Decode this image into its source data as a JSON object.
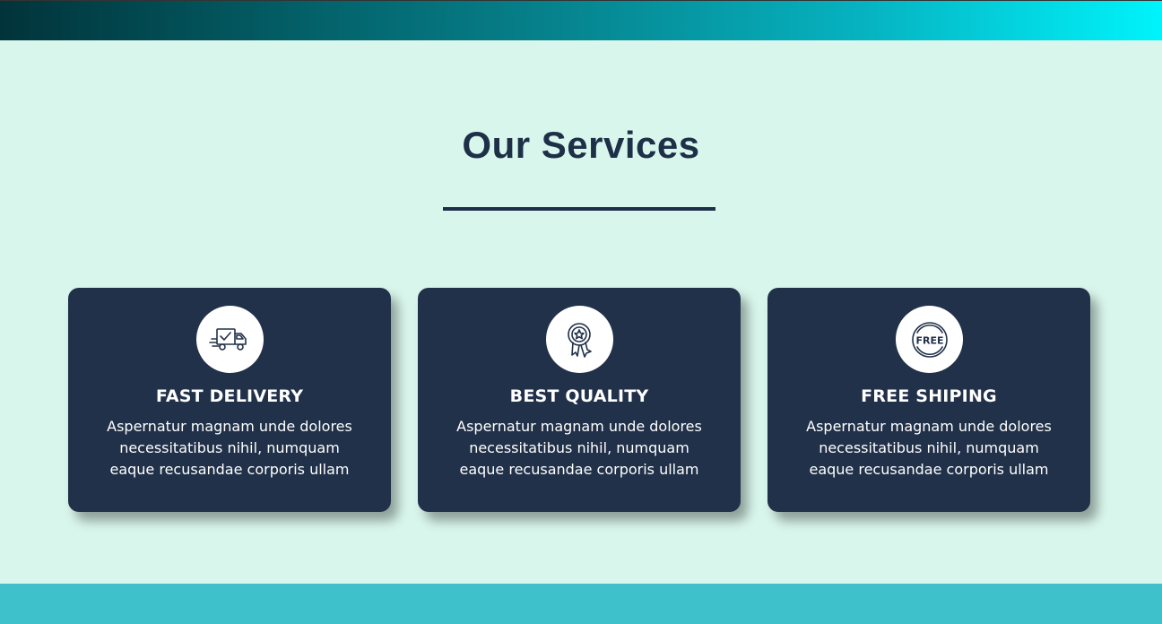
{
  "header": {
    "band_gradient": [
      "#02333a",
      "#067e88",
      "#00f3fb"
    ]
  },
  "services": {
    "title": "Our Services",
    "title_color": "#1e3047",
    "background": "#d9f6ec",
    "card_color": "#213149",
    "cards": [
      {
        "icon": "delivery-truck-icon",
        "title": "FAST DELIVERY",
        "text": "Aspernatur magnam unde dolores necessitatibus nihil, numquam eaque recusandae corporis ullam"
      },
      {
        "icon": "award-badge-icon",
        "title": "BEST QUALITY",
        "text": "Aspernatur magnam unde dolores necessitatibus nihil, numquam eaque recusandae corporis ullam"
      },
      {
        "icon": "free-stamp-icon",
        "icon_text": "FREE",
        "title": "FREE SHIPING",
        "text": "Aspernatur magnam unde dolores necessitatibus nihil, numquam eaque recusandae corporis ullam"
      }
    ]
  },
  "footer": {
    "band_color": "#3ec1ca"
  }
}
